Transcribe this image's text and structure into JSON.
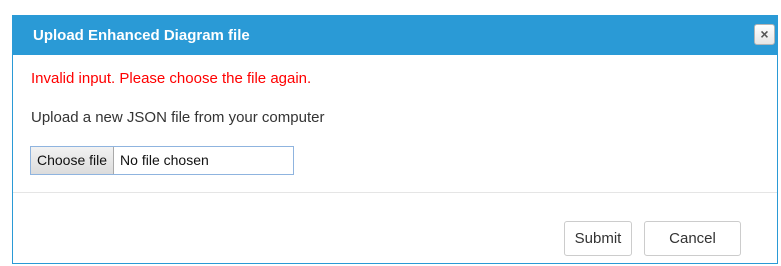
{
  "dialog": {
    "title": "Upload Enhanced Diagram file",
    "close_label": "×",
    "error_message": "Invalid input. Please choose the file again.",
    "instruction": "Upload a new JSON file from your computer",
    "file_input": {
      "button_label": "Choose file",
      "status": "No file chosen"
    },
    "buttons": {
      "submit_label": "Submit",
      "cancel_label": "Cancel"
    }
  },
  "colors": {
    "titlebar": "#2a9ad6",
    "error": "#ff0000"
  },
  "icons": {
    "close": "close-icon"
  }
}
